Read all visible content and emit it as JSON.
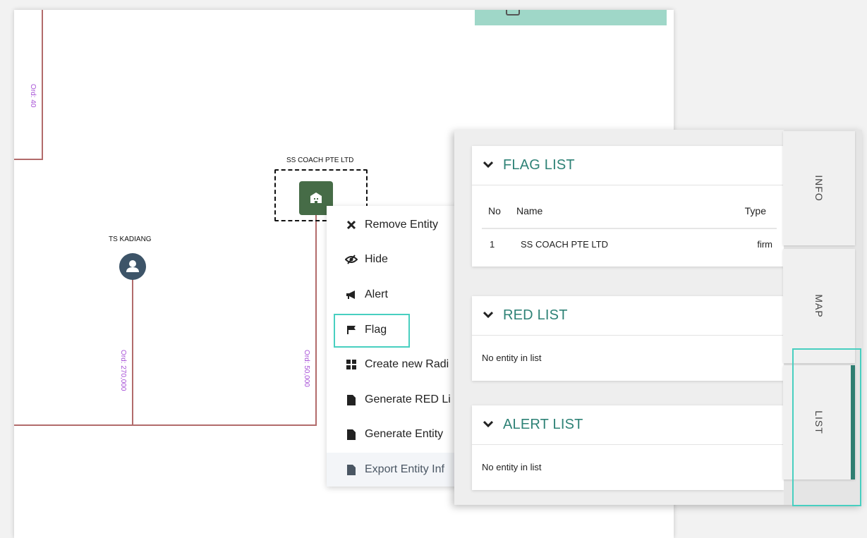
{
  "graph": {
    "edge_labels": [
      "Ord: 40",
      "Ord: 270,000",
      "Ord: 50,000"
    ],
    "nodes": {
      "person": {
        "label": "TS KADIANG",
        "icon": "user-icon",
        "color": "#3d5468"
      },
      "firm": {
        "label": "SS COACH PTE LTD",
        "icon": "building-icon",
        "color": "#466c47"
      }
    },
    "edge_color": "#b26b6b",
    "edge_label_color": "#a64fd6"
  },
  "context_menu": {
    "items": [
      {
        "label": "Remove Entity",
        "icon": "close-icon"
      },
      {
        "label": "Hide",
        "icon": "eye-slash-icon"
      },
      {
        "label": "Alert",
        "icon": "megaphone-icon"
      },
      {
        "label": "Flag",
        "icon": "flag-icon"
      },
      {
        "label": "Create new Radi",
        "icon": "grid-icon"
      },
      {
        "label": "Generate RED Li",
        "icon": "file-icon"
      },
      {
        "label": "Generate Entity",
        "icon": "file-icon"
      },
      {
        "label": "Export Entity Inf",
        "icon": "file-icon"
      }
    ]
  },
  "side_panel": {
    "flag_list": {
      "title": "FLAG LIST",
      "columns": [
        "No",
        "Name",
        "Type"
      ],
      "rows": [
        {
          "no": "1",
          "name": "SS COACH PTE LTD",
          "type": "firm"
        }
      ]
    },
    "red_list": {
      "title": "RED LIST",
      "empty_text": "No entity in list"
    },
    "alert_list": {
      "title": "ALERT LIST",
      "empty_text": "No entity in list"
    },
    "tabs": [
      {
        "label": "INFO",
        "active": false
      },
      {
        "label": "MAP",
        "active": false
      },
      {
        "label": "LIST",
        "active": true
      }
    ],
    "accent_color": "#2e8276",
    "highlight_color": "#48cfc0"
  }
}
